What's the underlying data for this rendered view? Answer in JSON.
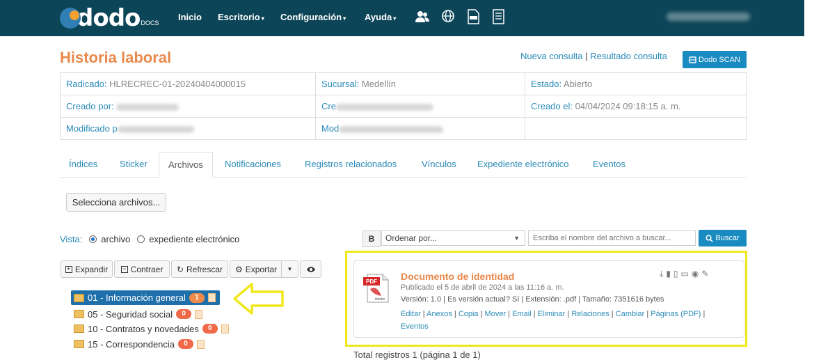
{
  "nav": {
    "logo_text": "dodo",
    "logo_sub": "DOCS",
    "items": [
      {
        "label": "Inicio",
        "caret": ""
      },
      {
        "label": "Escritorio",
        "caret": "▾"
      },
      {
        "label": "Configuración",
        "caret": "▾"
      },
      {
        "label": "Ayuda",
        "caret": "▾"
      }
    ],
    "icons": [
      "users-icon",
      "globe-icon",
      "xlsx-icon",
      "document-list-icon"
    ]
  },
  "page": {
    "title": "Historia laboral",
    "link_nueva": "Nueva consulta",
    "separator": "|",
    "link_resultado": "Resultado consulta",
    "scan_label": "Dodo SCAN"
  },
  "info": {
    "radicado_label": "Radicado:",
    "radicado_value": "HLRECREC-01-20240404000015",
    "sucursal_label": "Sucursal:",
    "sucursal_value": "Medellín",
    "estado_label": "Estado:",
    "estado_value": "Abierto",
    "creado_por_label": "Creado por:",
    "creado_en_label": "Cre",
    "creado_el_label": "Creado el:",
    "creado_el_value": "04/04/2024 09:18:15 a. m.",
    "modificado_label": "Modificado p",
    "mod_en_label": "Mod"
  },
  "tabs": [
    "Índices",
    "Sticker",
    "Archivos",
    "Notificaciones",
    "Registros relacionados",
    "Vínculos",
    "Expediente electrónico",
    "Eventos"
  ],
  "files": {
    "select_label": "Selecciona archivos...",
    "vista_label": "Vista:",
    "vista_opt1": "archivo",
    "vista_opt2": "expediente electrónico",
    "expandir": "Expandir",
    "contraer": "Contraer",
    "refrescar": "Refrescar",
    "exportar": "Exportar",
    "bold_btn": "B",
    "order_placeholder": "Ordenar por...",
    "search_placeholder": "Escriba el nombre del archivo a buscar...",
    "buscar": "Buscar"
  },
  "tree": [
    {
      "label": "01 - Información general",
      "count": "1"
    },
    {
      "label": "05 - Seguridad social",
      "count": "0"
    },
    {
      "label": "10 - Contratos y novedades",
      "count": "0"
    },
    {
      "label": "15 - Correspondencia",
      "count": "0"
    }
  ],
  "document": {
    "title": "Documento de identidad",
    "published": "Publicado el 5 de abril de 2024 a las 11:16 a. m.",
    "meta": "Versión: 1.0 | Es versión actual? Sí | Extensión: .pdf | Tamaño: 7351616 bytes",
    "actions": [
      "Editar",
      "Anexos",
      "Copia",
      "Mover",
      "Email",
      "Eliminar",
      "Relaciones",
      "Cambiar",
      "Páginas (PDF)",
      "Eventos"
    ],
    "pdf_label": "PDF",
    "adobe_label": "Adobe"
  },
  "footer": "Total registros 1 (página 1 de 1)",
  "colors": {
    "navbar": "#0d4558",
    "accent_orange": "#e8884a",
    "link_blue": "#2a8bb8",
    "highlight_yellow": "#f0e81a"
  }
}
